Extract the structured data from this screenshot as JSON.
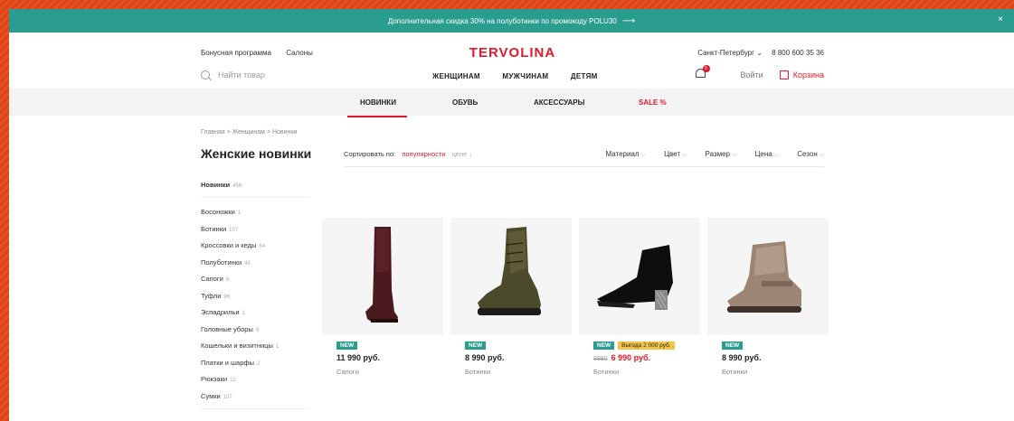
{
  "promo": {
    "text": "Дополнительная скидка 30% на полуботинки по промокоду POLU30",
    "arrow": "⟶",
    "close": "×"
  },
  "header": {
    "links": [
      "Бонусная программа",
      "Салоны"
    ],
    "logo": "TERVOLINA",
    "city": "Санкт-Петербург ⌄",
    "phone": "8 800 600 35 36",
    "search_placeholder": "Найти товар",
    "main_nav": [
      "ЖЕНЩИНАМ",
      "МУЖЧИНАМ",
      "ДЕТЯМ"
    ],
    "notifications_count": "5",
    "login": "Войти",
    "cart": "Корзина"
  },
  "category_nav": [
    "НОВИНКИ",
    "ОБУВЬ",
    "АКСЕССУАРЫ",
    "SALE %"
  ],
  "breadcrumb": "Главная > Женщинам > Новинки",
  "page_title": "Женские новинки",
  "sort": {
    "label": "Сортировать по:",
    "active": "популярности",
    "other": "цене ↓"
  },
  "filters": [
    "Материал",
    "Цвет",
    "Размер",
    "Цена",
    "Сезон"
  ],
  "sidebar": {
    "first": {
      "label": "Новинки",
      "count": "456"
    },
    "items": [
      {
        "label": "Босоножки",
        "count": "1"
      },
      {
        "label": "Ботинки",
        "count": "107"
      },
      {
        "label": "Кроссовки и кеды",
        "count": "64"
      },
      {
        "label": "Полуботинки",
        "count": "48"
      },
      {
        "label": "Сапоги",
        "count": "8"
      },
      {
        "label": "Туфли",
        "count": "96"
      },
      {
        "label": "Эспадрильи",
        "count": "1"
      },
      {
        "label": "Головные уборы",
        "count": "9"
      },
      {
        "label": "Кошельки и визитницы",
        "count": "1"
      },
      {
        "label": "Платки и шарфы",
        "count": "2"
      },
      {
        "label": "Рюкзаки",
        "count": "12"
      },
      {
        "label": "Сумки",
        "count": "107"
      }
    ]
  },
  "products": [
    {
      "badge": "NEW",
      "price": "11 990 руб.",
      "category": "Сапоги"
    },
    {
      "badge": "NEW",
      "price": "8 990 руб.",
      "category": "Ботинки"
    },
    {
      "badge": "NEW",
      "promo": "Выгода 2 000 руб.",
      "old_price": "8990",
      "price": "6 990 руб.",
      "category": "Ботинки"
    },
    {
      "badge": "NEW",
      "price": "8 990 руб.",
      "category": "Ботинки"
    }
  ]
}
